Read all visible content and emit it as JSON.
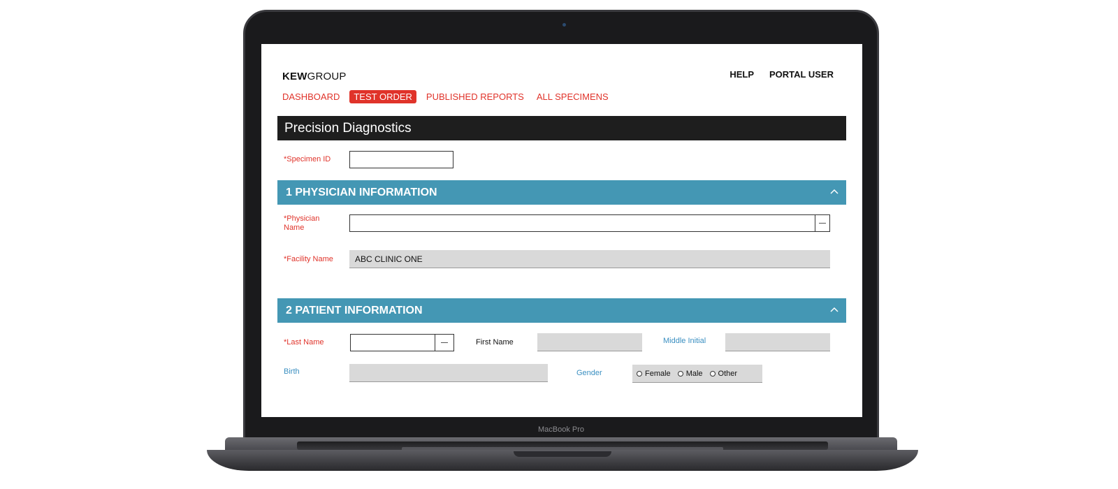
{
  "device": {
    "model_label": "MacBook Pro"
  },
  "header": {
    "logo": {
      "bold": "KEW",
      "regular": "GROUP"
    },
    "utility_links": [
      {
        "label": "HELP"
      },
      {
        "label": "PORTAL USER"
      }
    ],
    "nav": [
      {
        "label": "DASHBOARD",
        "active": false
      },
      {
        "label": "TEST ORDER",
        "active": true
      },
      {
        "label": "PUBLISHED REPORTS",
        "active": false
      },
      {
        "label": "ALL SPECIMENS",
        "active": false
      }
    ]
  },
  "page_title": "Precision Diagnostics",
  "specimen": {
    "label": "*Specimen ID",
    "value": ""
  },
  "physician_section": {
    "title": "1 PHYSICIAN INFORMATION",
    "physician_name": {
      "label_line1": "*Physician",
      "label_line2": "Name",
      "value": ""
    },
    "facility_name": {
      "label": "*Facility Name",
      "value": "ABC CLINIC ONE"
    }
  },
  "patient_section": {
    "title": "2 PATIENT INFORMATION",
    "last_name": {
      "label": "*Last Name",
      "value": ""
    },
    "first_name": {
      "label": "First Name",
      "value": ""
    },
    "middle_initial": {
      "label": "Middle Initial",
      "value": ""
    },
    "birth": {
      "label": "Birth",
      "value": ""
    },
    "gender": {
      "label": "Gender",
      "options": [
        "Female",
        "Male",
        "Other"
      ],
      "selected": null
    }
  },
  "colors": {
    "accent_red": "#e0332a",
    "section_blue": "#4497b4",
    "title_bar": "#1e1e1e",
    "optional_label_blue": "#3a8fc1",
    "readonly_grey": "#d9d9d9"
  }
}
